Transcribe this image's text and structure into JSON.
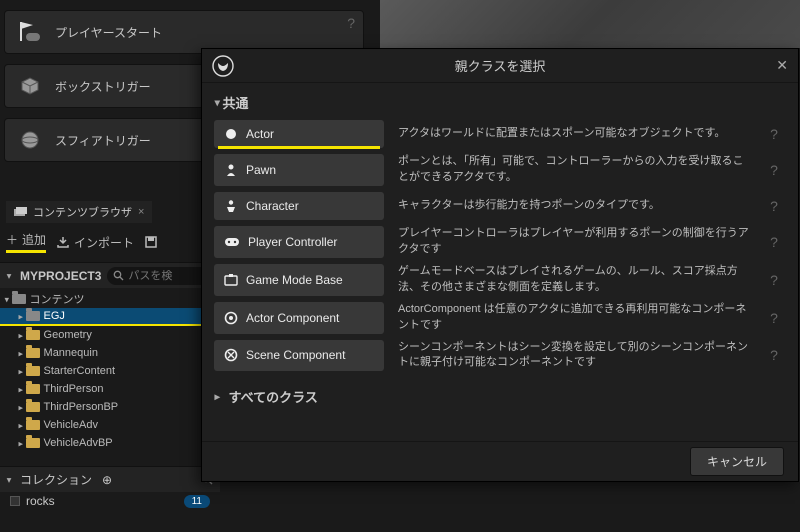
{
  "place_panel": {
    "items": [
      {
        "label": "プレイヤースタート"
      },
      {
        "label": "ボックストリガー"
      },
      {
        "label": "スフィアトリガー"
      }
    ]
  },
  "content_browser": {
    "tab_label": "コンテンツブラウザ",
    "add_label": "追加",
    "import_label": "インポート",
    "save_aria": "すべて保存",
    "project_header": "MYPROJECT3",
    "search_placeholder": "パスを検",
    "tree_root": "コンテンツ",
    "folders": [
      "EGJ",
      "Geometry",
      "Mannequin",
      "StarterContent",
      "ThirdPerson",
      "ThirdPersonBP",
      "VehicleAdv",
      "VehicleAdvBP"
    ],
    "collections_label": "コレクション",
    "collection_item": "rocks",
    "collection_count": "11"
  },
  "dialog": {
    "title": "親クラスを選択",
    "section_common": "共通",
    "classes": [
      {
        "name": "Actor",
        "desc": "アクタはワールドに配置またはスポーン可能なオブジェクトです。",
        "highlight": true
      },
      {
        "name": "Pawn",
        "desc": "ポーンとは、「所有」可能で、コントローラーからの入力を受け取ることができるアクタです。"
      },
      {
        "name": "Character",
        "desc": "キャラクターは歩行能力を持つポーンのタイプです。"
      },
      {
        "name": "Player Controller",
        "desc": "プレイヤーコントローラはプレイヤーが利用するポーンの制御を行うアクタです"
      },
      {
        "name": "Game Mode Base",
        "desc": "ゲームモードベースはプレイされるゲームの、ルール、スコア採点方法、その他さまざまな側面を定義します。"
      },
      {
        "name": "Actor Component",
        "desc": "ActorComponent は任意のアクタに追加できる再利用可能なコンポーネントです"
      },
      {
        "name": "Scene Component",
        "desc": "シーンコンポーネントはシーン変換を設定して別のシーンコンポーネントに親子付け可能なコンポーネントです"
      }
    ],
    "all_classes": "すべてのクラス",
    "cancel": "キャンセル"
  }
}
